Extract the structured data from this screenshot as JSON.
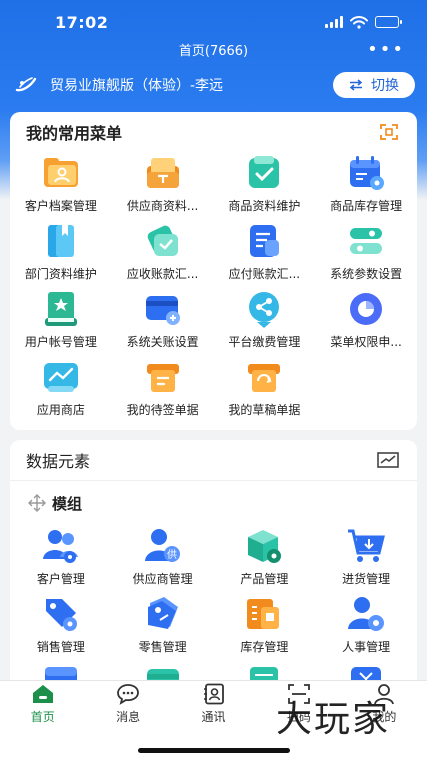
{
  "status": {
    "time": "17:02"
  },
  "header": {
    "title": "首页(7666)",
    "more": "•••"
  },
  "org": {
    "name": "贸易业旗舰版（体验）-李远",
    "switch_label": "切换",
    "switch_icon": "swap-arrows-icon"
  },
  "favorites": {
    "title": "我的常用菜单",
    "items": [
      {
        "label": "客户档案管理",
        "icon": "customer-folder-icon"
      },
      {
        "label": "供应商资料...",
        "icon": "supplier-folder-icon"
      },
      {
        "label": "商品资料维护",
        "icon": "product-check-icon"
      },
      {
        "label": "商品库存管理",
        "icon": "inventory-calendar-icon"
      },
      {
        "label": "部门资料维护",
        "icon": "department-book-icon"
      },
      {
        "label": "应收账款汇...",
        "icon": "receivable-tag-icon"
      },
      {
        "label": "应付账款汇...",
        "icon": "payable-document-icon"
      },
      {
        "label": "系统参数设置",
        "icon": "system-parameter-icon"
      },
      {
        "label": "用户帐号管理",
        "icon": "user-account-book-icon"
      },
      {
        "label": "系统关账设置",
        "icon": "close-account-card-icon"
      },
      {
        "label": "平台缴费管理",
        "icon": "payment-share-icon"
      },
      {
        "label": "菜单权限申...",
        "icon": "permission-pie-icon"
      },
      {
        "label": "应用商店",
        "icon": "app-store-chart-icon"
      },
      {
        "label": "我的待签单据",
        "icon": "pending-sign-ticket-icon"
      },
      {
        "label": "我的草稿单据",
        "icon": "draft-ticket-icon"
      }
    ]
  },
  "data_elements": {
    "title": "数据元素",
    "module_title": "模组",
    "items": [
      {
        "label": "客户管理",
        "icon": "customer-people-icon"
      },
      {
        "label": "供应商管理",
        "icon": "supplier-person-icon",
        "badge": "供"
      },
      {
        "label": "产品管理",
        "icon": "product-box-icon"
      },
      {
        "label": "进货管理",
        "icon": "purchase-cart-icon"
      },
      {
        "label": "销售管理",
        "icon": "sales-tag-icon"
      },
      {
        "label": "零售管理",
        "icon": "retail-tag-icon"
      },
      {
        "label": "库存管理",
        "icon": "stock-warehouse-icon"
      },
      {
        "label": "人事管理",
        "icon": "hr-person-gear-icon"
      }
    ]
  },
  "tabbar": {
    "items": [
      {
        "label": "首页",
        "icon": "home-icon",
        "active": true
      },
      {
        "label": "消息",
        "icon": "message-bubble-icon"
      },
      {
        "label": "通讯",
        "icon": "contacts-book-icon"
      },
      {
        "label": "扫码",
        "icon": "scan-icon"
      },
      {
        "label": "我的",
        "icon": "profile-icon"
      }
    ]
  },
  "watermark": "大玩家",
  "colors": {
    "primary": "#1f6fe6",
    "active_tab": "#1c8f4a",
    "orange": "#f28b1e",
    "teal": "#2bc3a8",
    "blue": "#2e6ef0"
  }
}
